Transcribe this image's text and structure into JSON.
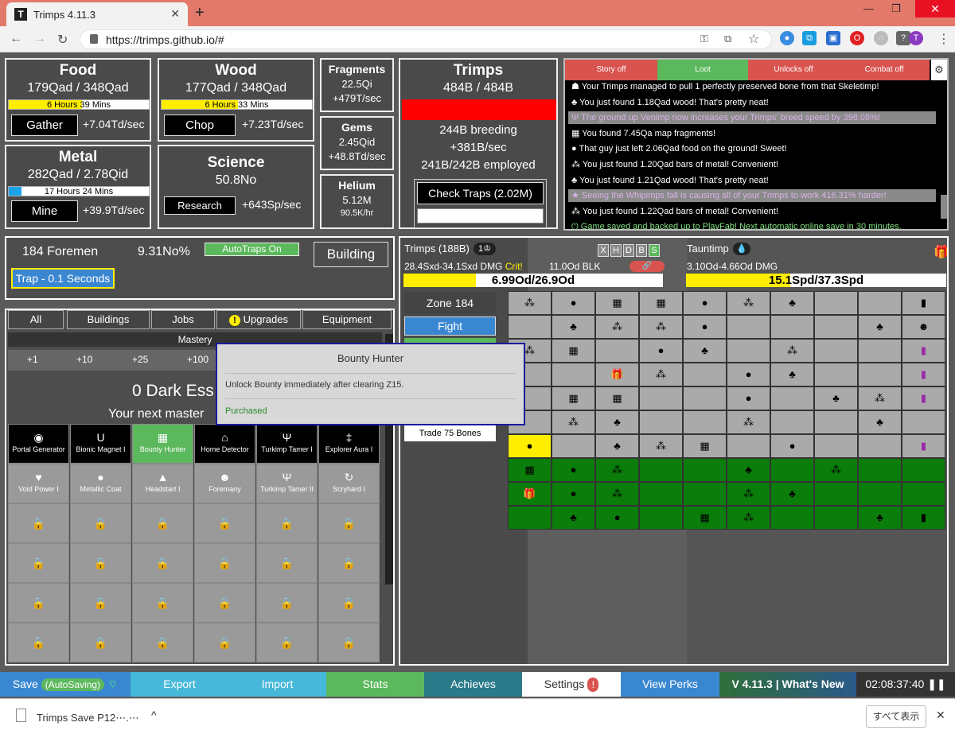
{
  "browser": {
    "tab_title": "Trimps 4.11.3",
    "tab_favicon": "T",
    "url": "https://trimps.github.io/#",
    "profile_initial": "T"
  },
  "resources": {
    "food": {
      "name": "Food",
      "amount": "179Qad / 348Qad",
      "bar_label_a": "6 Hours",
      "bar_label_b": "39 Mins",
      "button": "Gather",
      "rate": "+7.04Td/sec"
    },
    "wood": {
      "name": "Wood",
      "amount": "177Qad / 348Qad",
      "bar_label_a": "6 Hours",
      "bar_label_b": "33 Mins",
      "button": "Chop",
      "rate": "+7.23Td/sec"
    },
    "metal": {
      "name": "Metal",
      "amount": "282Qad / 2.78Qid",
      "bar_label": "17 Hours 24 Mins",
      "button": "Mine",
      "rate": "+39.9Td/sec"
    },
    "science": {
      "name": "Science",
      "amount": "50.8No",
      "button": "Research",
      "rate": "+643Sp/sec"
    },
    "fragments": {
      "name": "Fragments",
      "amount": "22.5Qi",
      "rate": "+479T/sec"
    },
    "gems": {
      "name": "Gems",
      "amount": "2.45Qid",
      "rate": "+48.8Td/sec"
    },
    "helium": {
      "name": "Helium",
      "amount": "5.12M",
      "rate": "90.5K/hr"
    }
  },
  "trimps": {
    "title": "Trimps",
    "amount": "484B / 484B",
    "breeding": "244B breeding",
    "rate": "+381B/sec",
    "employed": "241B/242B employed",
    "check_traps": "Check Traps (2.02M)"
  },
  "log_filters": [
    "Story off",
    "Loot",
    "Unlocks off",
    "Combat off"
  ],
  "messages": [
    {
      "icon": "bone-icon",
      "text": "Your Trimps managed to pull 1 perfectly preserved bone from that Skeletimp!",
      "style": "normal"
    },
    {
      "icon": "tree-icon",
      "text": "You just found 1.18Qad wood! That's pretty neat!",
      "style": "normal"
    },
    {
      "icon": "cup-icon",
      "text": "The ground up Venimp now increases your Trimps' breed speed by 398.08%!",
      "style": "highlight"
    },
    {
      "icon": "map-icon",
      "text": "You found 7.45Qa map fragments!",
      "style": "normal"
    },
    {
      "icon": "apple-icon",
      "text": "That guy just left 2.06Qad food on the ground! Sweet!",
      "style": "normal"
    },
    {
      "icon": "metal-icon",
      "text": "You just found 1.20Qad bars of metal! Convenient!",
      "style": "normal"
    },
    {
      "icon": "tree-icon",
      "text": "You just found 1.21Qad wood! That's pretty neat!",
      "style": "normal"
    },
    {
      "icon": "star-icon",
      "text": "Seeing the Whipimps fall is causing all of your Trimps to work 416.31% harder!",
      "style": "highlight"
    },
    {
      "icon": "metal-icon",
      "text": "You just found 1.22Qad bars of metal! Convenient!",
      "style": "normal"
    },
    {
      "icon": "save-icon",
      "text": "Game saved and backed up to PlayFab! Next automatic online save in 30 minutes.",
      "style": "save"
    }
  ],
  "buildings_panel": {
    "foremen": "184 Foremen",
    "value": "9.31No%",
    "autotraps": "AutoTraps On",
    "building": "Building",
    "trap": "Trap - 0.1 Seconds"
  },
  "tabs": [
    "All",
    "Buildings",
    "Jobs",
    "Upgrades",
    "Equipment"
  ],
  "mastery": {
    "label": "Mastery",
    "increments": [
      "+1",
      "+10",
      "+25",
      "+100"
    ],
    "dark_essence": "0 Dark Ess",
    "next_mastery": "Your next master"
  },
  "upgrades_row1": [
    "Portal Generator",
    "Bionic Magnet I",
    "Bounty Hunter",
    "Home Detector",
    "Turkimp Tamer I",
    "Explorer Aura I"
  ],
  "upgrades_row2": [
    "Void Power I",
    "Metallic Coat",
    "Headstart I",
    "Foremany",
    "Turkimp Tamer II",
    "Scryhard I"
  ],
  "tooltip": {
    "title": "Bounty Hunter",
    "desc": "Unlock Bounty immediately after clearing Z15.",
    "status": "Purchased"
  },
  "battle": {
    "trimps_label": "Trimps (188B)",
    "trimps_badge": "1",
    "trimps_dmg": "28.4Sxd-34.1Sxd DMG",
    "crit": "Crit!",
    "block": "11.0Od BLK",
    "trimps_hp": "6.99Od/26.9Od",
    "trimps_hp_fraction": 0.28,
    "toggles": [
      "X",
      "H",
      "D",
      "B",
      "S"
    ],
    "enemy_label": "Tauntimp",
    "enemy_dmg": "3.10Od-4.66Od DMG",
    "enemy_hp": "15.1Spd/37.3Spd",
    "enemy_hp_fraction": 0.4,
    "zone": "Zone 184",
    "fight": "Fight",
    "trade_bones": "Trade 75 Bones"
  },
  "grid": [
    [
      "metal",
      "apple",
      "map",
      "map",
      "apple",
      "metal",
      "tree",
      "",
      "",
      "book"
    ],
    [
      "",
      "tree",
      "metal",
      "metal",
      "apple",
      "",
      "",
      "",
      "tree",
      "person"
    ],
    [
      "metal",
      "map",
      "",
      "apple",
      "tree",
      "",
      "metal",
      "",
      "",
      "purple"
    ],
    [
      "",
      "",
      "gift",
      "metal",
      "",
      "apple",
      "tree",
      "",
      "",
      "purple"
    ],
    [
      "",
      "map",
      "map",
      "",
      "",
      "apple",
      "",
      "tree",
      "metal",
      "purple"
    ],
    [
      "",
      "metal",
      "tree",
      "",
      "",
      "metal",
      "",
      "",
      "tree",
      ""
    ],
    [
      "apple",
      "",
      "tree",
      "metal",
      "map",
      "",
      "apple",
      "",
      "",
      "purple"
    ],
    [
      "map",
      "apple",
      "metal",
      "",
      "",
      "tree",
      "",
      "metal",
      "",
      ""
    ],
    [
      "gift",
      "apple",
      "metal",
      "",
      "",
      "metal",
      "tree",
      "",
      "",
      ""
    ],
    [
      "",
      "tree",
      "apple",
      "",
      "map",
      "metal",
      "",
      "",
      "tree",
      "book"
    ]
  ],
  "bottom_bar": {
    "save": "Save",
    "autosaving": "(AutoSaving)",
    "export": "Export",
    "import": "Import",
    "stats": "Stats",
    "achieves": "Achieves",
    "settings": "Settings",
    "view_perks": "View Perks",
    "version": "V 4.11.3 | What's New",
    "time": "02:08:37:40"
  },
  "download": {
    "file": "Trimps Save P12⋯.⋯",
    "show_all": "すべて表示"
  },
  "colors": {
    "accent_blue": "#3a87d1",
    "accent_green": "#5cb85c",
    "danger_red": "#d9534f"
  }
}
